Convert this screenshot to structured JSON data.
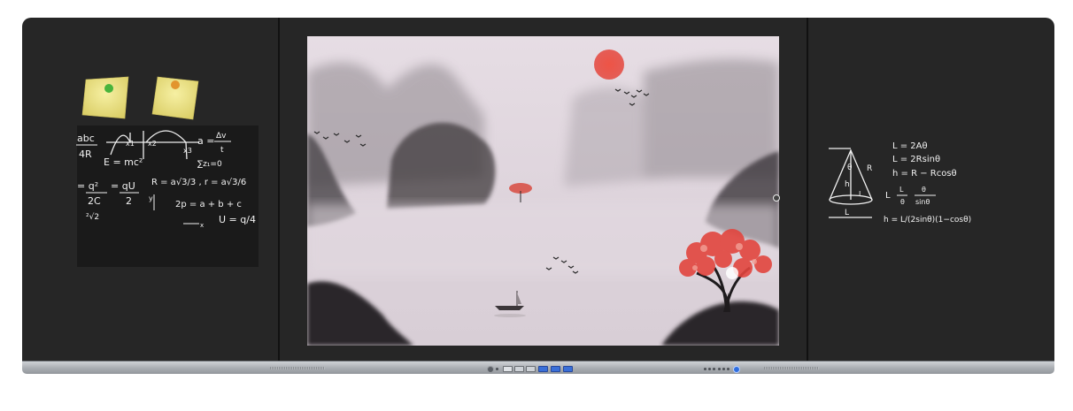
{
  "left_board": {
    "formulas": {
      "fraction_top": "abc",
      "fraction_bottom": "4R",
      "energy": "E = mc²",
      "alpha_eq": "a =",
      "alpha_num": "Δv",
      "alpha_den": "t",
      "sum": "∑z₁=0",
      "eq_q": "= q²",
      "eq_q_den": "2C",
      "eq_qv": "= qU",
      "eq_qv_den": "2",
      "radius": "R = a√3/3 , r = a√3/6",
      "perimeter": "2p = a + b + c",
      "root2": "²√2",
      "ratio": "U = q/4",
      "axis_x1": "x1",
      "axis_x2": "x2",
      "axis_x3": "x3",
      "axis_x": "x",
      "axis_y": "y"
    }
  },
  "right_board": {
    "formulas": {
      "l1": "L = 2Aθ",
      "l2": "L = 2Rsinθ",
      "l3": "h = R − Rcosθ",
      "l4_a": "L",
      "l4_b": "θ",
      "l4_c": "L",
      "l4_d": "sinθ",
      "l5": "h = L/(2sinθ)(1−cosθ)",
      "cone_theta": "θ",
      "cone_r": "R",
      "cone_h": "h",
      "cone_l": "L",
      "cone_base": "L"
    }
  },
  "colors": {
    "board": "#262626",
    "tray": "#b1b4b8",
    "sun": "#e8463c",
    "tree": "#e2453e",
    "note": "#ece27e"
  }
}
